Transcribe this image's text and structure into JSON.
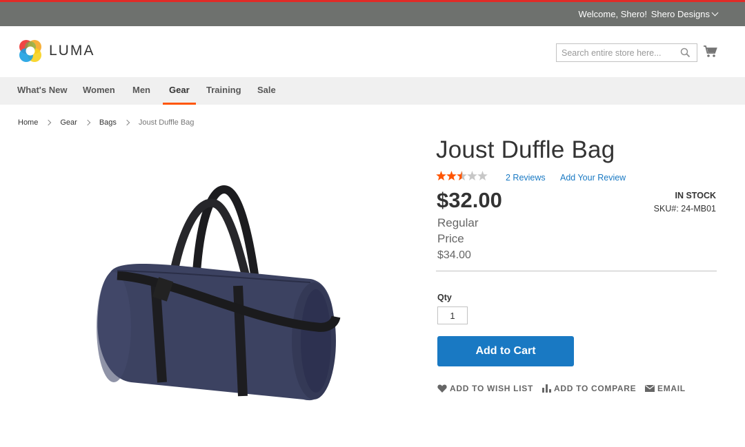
{
  "header": {
    "welcome": "Welcome, Shero!",
    "account": "Shero Designs"
  },
  "logo": {
    "text": "LUMA"
  },
  "search": {
    "placeholder": "Search entire store here..."
  },
  "nav": {
    "items": [
      "What's New",
      "Women",
      "Men",
      "Gear",
      "Training",
      "Sale"
    ],
    "active": "Gear"
  },
  "breadcrumbs": [
    "Home",
    "Gear",
    "Bags",
    "Joust Duffle Bag"
  ],
  "product": {
    "title": "Joust Duffle Bag",
    "rating_stars": 2.5,
    "rating_max": 5,
    "reviews_link": "2 Reviews",
    "add_review_link": "Add Your Review",
    "stock": "IN STOCK",
    "sku": "SKU#:  24-MB01",
    "price": "$32.00",
    "regular_price_label": "Regular Price",
    "old_price": "$34.00",
    "qty_label": "Qty",
    "qty_value": "1",
    "add_to_cart": "Add to Cart",
    "wish_list": "ADD TO WISH LIST",
    "compare": "ADD TO COMPARE",
    "email": "EMAIL"
  },
  "colors": {
    "accent_blue": "#1979c3",
    "nav_active_underline": "#ff5501",
    "top_bar": "#6e716e",
    "star_filled": "#ff5501"
  }
}
